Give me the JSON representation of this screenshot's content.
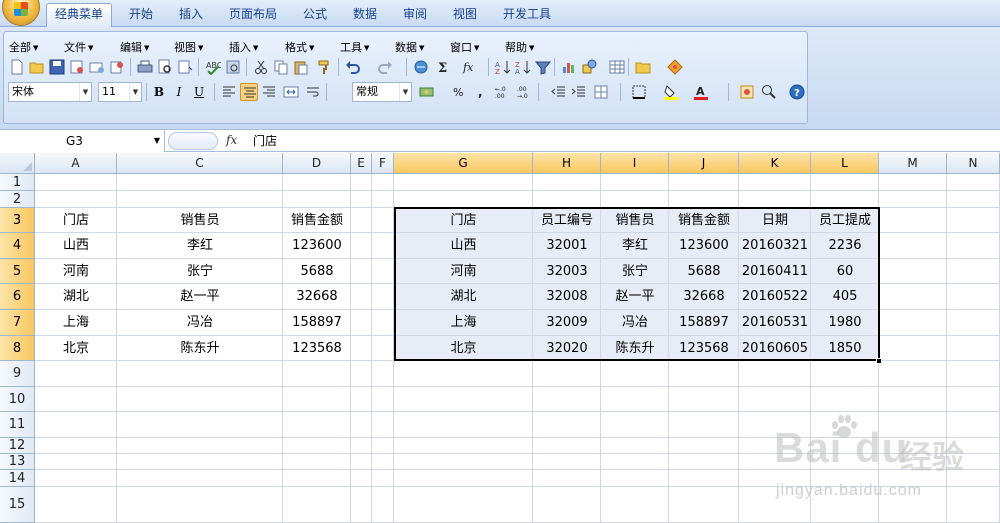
{
  "ribbon": {
    "tabs": [
      {
        "label": "经典菜单",
        "active": true
      },
      {
        "label": "开始"
      },
      {
        "label": "插入"
      },
      {
        "label": "页面布局"
      },
      {
        "label": "公式"
      },
      {
        "label": "数据"
      },
      {
        "label": "审阅"
      },
      {
        "label": "视图"
      },
      {
        "label": "开发工具"
      }
    ],
    "menus": [
      "全部",
      "文件",
      "编辑",
      "视图",
      "插入",
      "格式",
      "工具",
      "数据",
      "窗口",
      "帮助"
    ],
    "font_name": "宋体",
    "font_size": "11",
    "number_format": "常规",
    "bold_label": "B",
    "italic_label": "I",
    "underline_label": "U"
  },
  "formula_bar": {
    "name_box": "G3",
    "fx_label": "fx",
    "value": "门店"
  },
  "grid": {
    "columns": [
      "A",
      "C",
      "D",
      "E",
      "F",
      "G",
      "H",
      "I",
      "J",
      "K",
      "L",
      "M",
      "N"
    ],
    "rows": [
      "1",
      "2",
      "3",
      "4",
      "5",
      "6",
      "7",
      "8",
      "9",
      "10",
      "11",
      "12",
      "13",
      "14",
      "15"
    ],
    "selected_columns": [
      "G",
      "H",
      "I",
      "J",
      "K",
      "L"
    ],
    "selected_rows": [
      "3",
      "4",
      "5",
      "6",
      "7",
      "8"
    ],
    "left_table": {
      "headers": [
        "门店",
        "销售员",
        "销售金额"
      ],
      "rows": [
        [
          "山西",
          "李红",
          "123600"
        ],
        [
          "河南",
          "张宁",
          "5688"
        ],
        [
          "湖北",
          "赵一平",
          "32668"
        ],
        [
          "上海",
          "冯冶",
          "158897"
        ],
        [
          "北京",
          "陈东升",
          "123568"
        ]
      ]
    },
    "right_table": {
      "headers": [
        "门店",
        "员工编号",
        "销售员",
        "销售金额",
        "日期",
        "员工提成"
      ],
      "rows": [
        [
          "山西",
          "32001",
          "李红",
          "123600",
          "20160321",
          "2236"
        ],
        [
          "河南",
          "32003",
          "张宁",
          "5688",
          "20160411",
          "60"
        ],
        [
          "湖北",
          "32008",
          "赵一平",
          "32668",
          "20160522",
          "405"
        ],
        [
          "上海",
          "32009",
          "冯冶",
          "158897",
          "20160531",
          "1980"
        ],
        [
          "北京",
          "32020",
          "陈东升",
          "123568",
          "20160605",
          "1850"
        ]
      ]
    }
  },
  "watermark": {
    "logo": "Bai du",
    "text": "经验",
    "url": "jingyan.baidu.com"
  }
}
